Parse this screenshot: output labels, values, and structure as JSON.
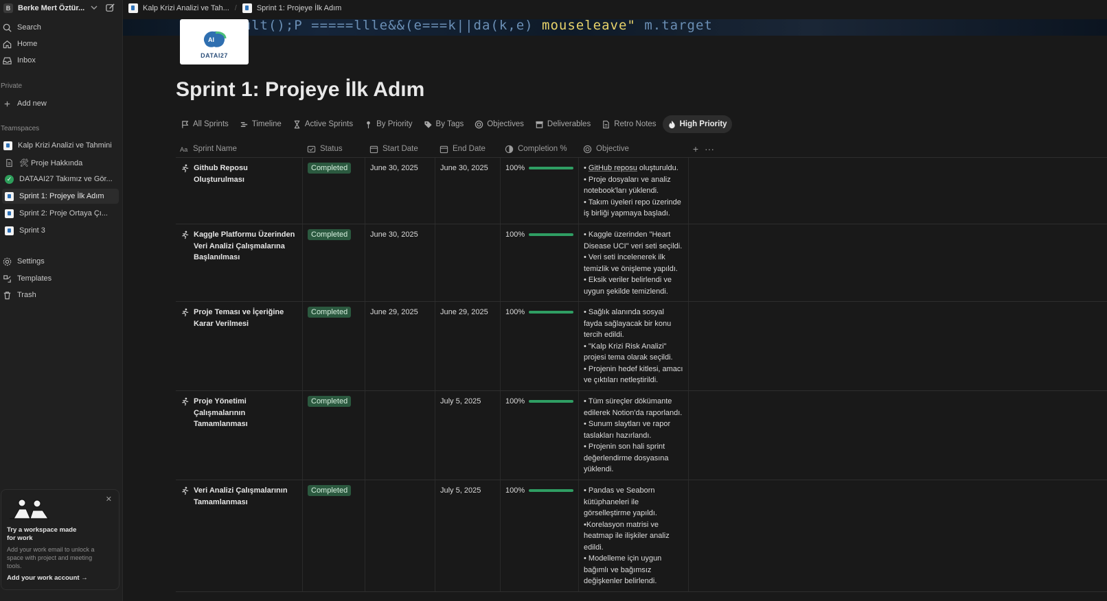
{
  "workspace": {
    "initial": "B",
    "name": "Berke Mert Öztür..."
  },
  "sidebar": {
    "nav": [
      {
        "label": "Search",
        "icon": "search-icon"
      },
      {
        "label": "Home",
        "icon": "home-icon"
      },
      {
        "label": "Inbox",
        "icon": "inbox-icon"
      }
    ],
    "private_label": "Private",
    "add_new": "Add new",
    "teamspaces_label": "Teamspaces",
    "tree": [
      {
        "label": "Kalp Krizi Analizi ve Tahmini",
        "icon": "page-icon"
      },
      {
        "label": "🛠 Proje Hakkında",
        "icon": "doc-icon"
      },
      {
        "label": "DATAAI27 Takımız ve Gör...",
        "icon": "check-circle-icon"
      },
      {
        "label": "Sprint 1: Projeye İlk Adım",
        "icon": "page-icon",
        "active": true
      },
      {
        "label": "Sprint 2: Proje Ortaya Çı...",
        "icon": "page-icon"
      },
      {
        "label": "Sprint 3",
        "icon": "page-icon"
      }
    ],
    "bottom": [
      {
        "label": "Settings",
        "icon": "gear-icon"
      },
      {
        "label": "Templates",
        "icon": "templates-icon"
      },
      {
        "label": "Trash",
        "icon": "trash-icon"
      }
    ],
    "promo": {
      "title": "Try a workspace made for work",
      "body": "Add your work email to unlock a space with project and meeting tools.",
      "link": "Add your work account  →",
      "close": "✕"
    }
  },
  "tabs": [
    {
      "label": "Kalp Krizi Analizi ve Tah..."
    },
    {
      "label": "Sprint 1: Projeye İlk Adım"
    }
  ],
  "cover": {
    "code_a": "ntDefault();P",
    "code_b": "=====llle&&(e===k||da(k,e)",
    "code_c": "mouseleave\"",
    "code_d": "m.target"
  },
  "logo": {
    "text": "DATAI27",
    "mark": "AI"
  },
  "page": {
    "title": "Sprint 1: Projeye İlk Adım"
  },
  "views": [
    {
      "label": "All Sprints",
      "icon": "flag-icon"
    },
    {
      "label": "Timeline",
      "icon": "timeline-icon"
    },
    {
      "label": "Active Sprints",
      "icon": "hourglass-icon"
    },
    {
      "label": "By Priority",
      "icon": "pin-icon"
    },
    {
      "label": "By Tags",
      "icon": "tag-icon"
    },
    {
      "label": "Objectives",
      "icon": "target-icon"
    },
    {
      "label": "Deliverables",
      "icon": "archive-icon"
    },
    {
      "label": "Retro Notes",
      "icon": "notes-icon"
    },
    {
      "label": "High Priority",
      "icon": "fire-icon",
      "active": true
    }
  ],
  "table": {
    "columns": {
      "name": "Sprint Name",
      "status": "Status",
      "start": "Start Date",
      "end": "End Date",
      "completion": "Completion %",
      "objective": "Objective",
      "add": "+",
      "more": "···"
    },
    "rows": [
      {
        "name": "Github Reposu Oluşturulması",
        "status": "Completed",
        "start": "June 30, 2025",
        "end": "June 30, 2025",
        "completion": "100%",
        "completion_value": 1.0,
        "objective_link": "GitHub reposu",
        "objective_link_tail": " oluşturuldu.",
        "objective": [
          "• Proje dosyaları ve analiz notebook'ları yüklendi.",
          "• Takım üyeleri repo üzerinde iş birliği yapmaya başladı."
        ]
      },
      {
        "name": "Kaggle Platformu Üzerinden Veri Analizi Çalışmalarına Başlanılması",
        "status": "Completed",
        "start": "June 30, 2025",
        "end": "",
        "completion": "100%",
        "completion_value": 1.0,
        "objective": [
          "• Kaggle üzerinden \"Heart Disease UCI\" veri seti seçildi.",
          "• Veri seti incelenerek ilk temizlik ve önişleme yapıldı.",
          "• Eksik veriler belirlendi ve uygun şekilde temizlendi."
        ]
      },
      {
        "name": "Proje Teması ve İçeriğine Karar Verilmesi",
        "status": "Completed",
        "start": "June 29, 2025",
        "end": "June 29, 2025",
        "completion": "100%",
        "completion_value": 1.0,
        "objective": [
          "• Sağlık alanında sosyal fayda sağlayacak bir konu tercih edildi.",
          "• \"Kalp Krizi Risk Analizi\" projesi tema olarak seçildi.",
          "• Projenin hedef kitlesi, amacı ve çıktıları netleştirildi."
        ]
      },
      {
        "name": "Proje Yönetimi Çalışmalarının Tamamlanması",
        "status": "Completed",
        "start": "",
        "end": "July 5, 2025",
        "completion": "100%",
        "completion_value": 1.0,
        "objective": [
          "• Tüm süreçler dökümante edilerek Notion'da raporlandı.",
          "• Sunum slaytları ve rapor taslakları hazırlandı.",
          "• Projenin son hali sprint değerlendirme dosyasına yüklendi."
        ]
      },
      {
        "name": "Veri Analizi Çalışmalarının Tamamlanması",
        "status": "Completed",
        "start": "",
        "end": "July 5, 2025",
        "completion": "100%",
        "completion_value": 1.0,
        "objective": [
          "• Pandas ve Seaborn kütüphaneleri ile görselleştirme yapıldı.",
          "•Korelasyon matrisi ve heatmap ile ilişkiler analiz edildi.",
          "• Modelleme için uygun bağımlı ve bağımsız değişkenler belirlendi."
        ]
      }
    ]
  },
  "colors": {
    "background": "#191919",
    "sidebar": "#202020",
    "badge_bg": "#2b593f",
    "progress": "#2f9e63"
  }
}
